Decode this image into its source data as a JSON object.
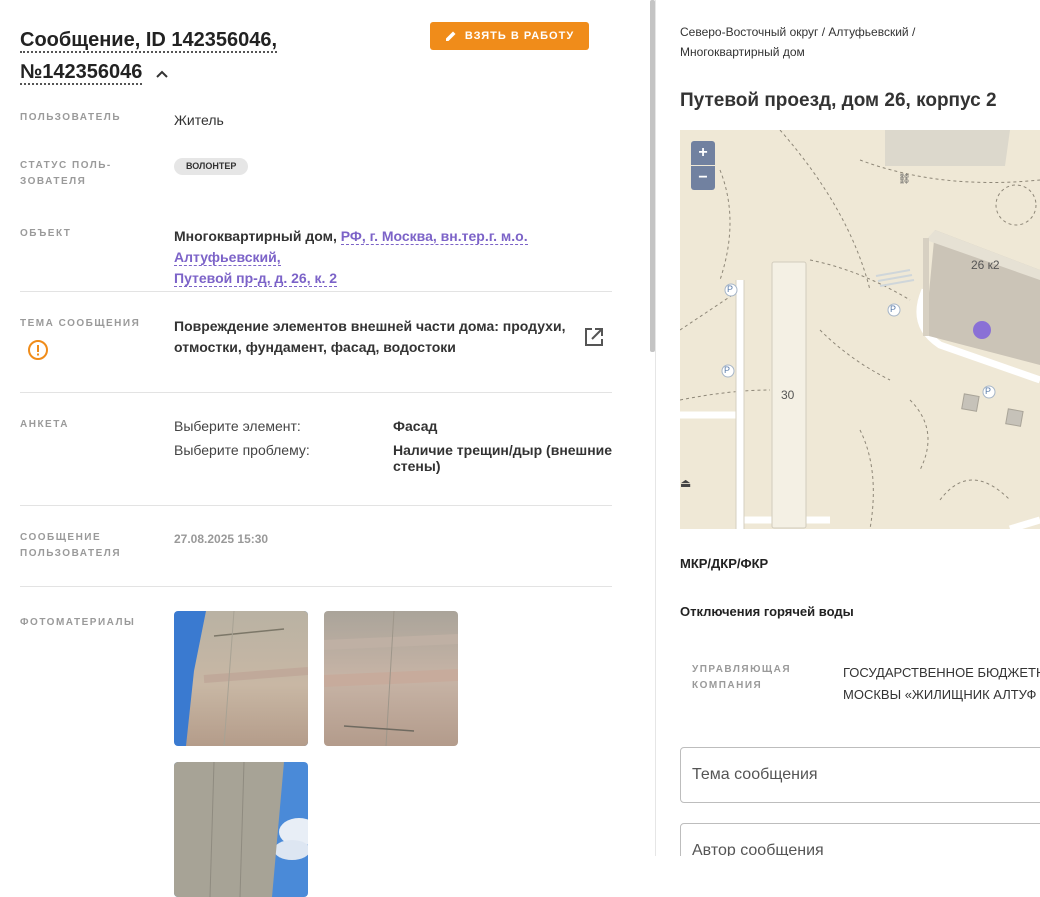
{
  "message": {
    "title_line1": "Сообщение, ID 142356046,",
    "title_line2": "№142356046",
    "take_button": "ВЗЯТЬ В РАБОТУ"
  },
  "fields": {
    "user_label": "ПОЛЬЗОВАТЕЛЬ",
    "user_value": "Житель",
    "status_label_1": "СТАТУС ПОЛЬ-",
    "status_label_2": "ЗОВАТЕЛЯ",
    "status_value": "ВОЛОНТЕР",
    "object_label": "ОБЪЕКТ",
    "object_type": "Многоквартирный дом,",
    "object_address_1": "РФ, г. Москва, вн.тер.г. м.о. Алтуфьевский,",
    "object_address_2": "Путевой пр-д, д. 26, к. 2",
    "topic_label": "ТЕМА СООБЩЕНИЯ",
    "topic_value_1": "Повреждение элементов внешней части дома: продухи,",
    "topic_value_2": "отмостки, фундамент, фасад, водостоки",
    "anketa_label": "АНКЕТА",
    "anketa": [
      {
        "question": "Выберите элемент:",
        "answer": "Фасад"
      },
      {
        "question": "Выберите проблему:",
        "answer": "Наличие трещин/дыр (внешние стены)"
      }
    ],
    "message_label_1": "СООБЩЕНИЕ",
    "message_label_2": "ПОЛЬЗОВАТЕЛЯ",
    "message_date": "27.08.2025 15:30",
    "photos_label": "ФОТОМАТЕРИАЛЫ"
  },
  "right": {
    "breadcrumb_1": "Северо-Восточный округ / Алтуфьевский /",
    "breadcrumb_2": "Многоквартирный дом",
    "address": "Путевой проезд, дом 26, корпус 2",
    "map": {
      "zoom_in": "+",
      "zoom_out": "−",
      "building_label": "26 к2",
      "building_30": "30",
      "parking": "P"
    },
    "section_mkr": "МКР/ДКР/ФКР",
    "section_hot_water": "Отключения горячей воды",
    "uk_label_1": "УПРАВЛЯЮЩАЯ",
    "uk_label_2": "КОМПАНИЯ",
    "uk_value_1": "ГОСУДАРСТВЕННОЕ БЮДЖЕТН",
    "uk_value_2": "МОСКВЫ «ЖИЛИЩНИК АЛТУФ",
    "topic_placeholder": "Тема сообщения",
    "author_placeholder": "Автор сообщения"
  },
  "colors": {
    "accent_orange": "#f08c1a",
    "link_purple": "#7c63c8",
    "marker": "#8a70d6"
  }
}
